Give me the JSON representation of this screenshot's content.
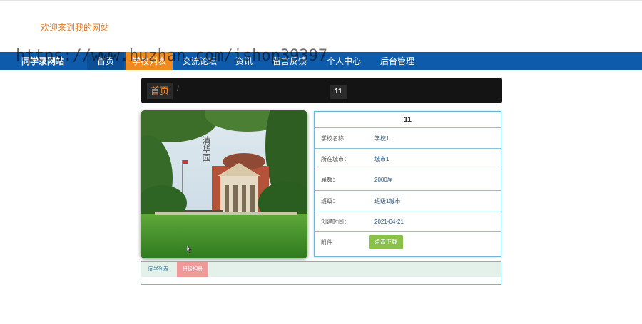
{
  "header": {
    "welcome": "欢迎来到我的网站"
  },
  "nav": {
    "brand": "同学录网站",
    "items": [
      {
        "label": "首页"
      },
      {
        "label": "学校列表"
      },
      {
        "label": "交流论坛"
      },
      {
        "label": "资讯"
      },
      {
        "label": "留言反馈"
      },
      {
        "label": "个人中心"
      },
      {
        "label": "后台管理"
      }
    ],
    "active_index": 1,
    "colors": {
      "bar": "#0e5bab",
      "active": "#ef8a20"
    }
  },
  "watermark": "https://www.huzhan.com/ishop39397",
  "breadcrumb": {
    "home": "首页",
    "separator": "/",
    "current": "11"
  },
  "detail": {
    "title": "11",
    "rows": [
      {
        "label": "学校名称：",
        "value": "学校1"
      },
      {
        "label": "所在城市：",
        "value": "城市1"
      },
      {
        "label": "届数：",
        "value": "2000届"
      },
      {
        "label": "班级：",
        "value": "班级1城市"
      },
      {
        "label": "创建时间：",
        "value": "2021-04-21"
      }
    ],
    "attachment_label": "附件：",
    "download_button": "点击下载"
  },
  "tabs": {
    "items": [
      {
        "label": "同学列表"
      },
      {
        "label": "班级相册"
      }
    ],
    "active_index": 1
  },
  "image": {
    "icon": "school-photo",
    "calligraphy": "清华园"
  }
}
